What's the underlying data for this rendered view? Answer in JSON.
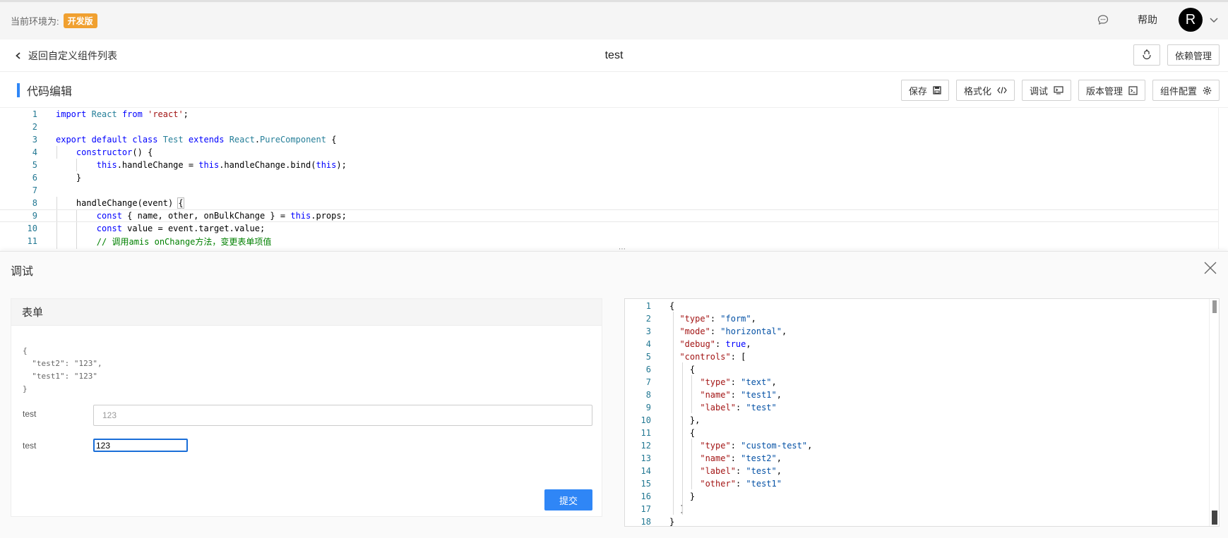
{
  "topbar": {
    "env_label": "当前环境为:",
    "env_badge": "开发版",
    "help": "帮助",
    "avatar_letter": "R"
  },
  "subheader": {
    "back": "返回自定义组件列表",
    "title": "test",
    "deps_button": "依赖管理"
  },
  "section": {
    "title": "代码编辑"
  },
  "toolbar": {
    "save": "保存",
    "format": "格式化",
    "debug": "调试",
    "version": "版本管理",
    "config": "组件配置"
  },
  "code_lines": [
    "import React from 'react';",
    "",
    "export default class Test extends React.PureComponent {",
    "    constructor() {",
    "        this.handleChange = this.handleChange.bind(this);",
    "    }",
    "",
    "    handleChange(event) {",
    "        const { name, other, onBulkChange } = this.props;",
    "        const value = event.target.value;",
    "        // 调用amis onChange方法，变更表单项值"
  ],
  "debug_panel": {
    "title": "调试",
    "form_title": "表单",
    "debug_json": "{\n  \"test2\": \"123\",\n  \"test1\": \"123\"\n}",
    "field1_label": "test",
    "field1_value": "123",
    "field2_label": "test",
    "field2_value": "123",
    "submit": "提交"
  },
  "json_lines": [
    "{",
    "  \"type\": \"form\",",
    "  \"mode\": \"horizontal\",",
    "  \"debug\": true,",
    "  \"controls\": [",
    "    {",
    "      \"type\": \"text\",",
    "      \"name\": \"test1\",",
    "      \"label\": \"test\"",
    "    },",
    "    {",
    "      \"type\": \"custom-test\",",
    "      \"name\": \"test2\",",
    "      \"label\": \"test\",",
    "      \"other\": \"test1\"",
    "    }",
    "  ]",
    "}"
  ],
  "colors": {
    "accent": "#2f86f6",
    "badge": "#f0a030"
  }
}
